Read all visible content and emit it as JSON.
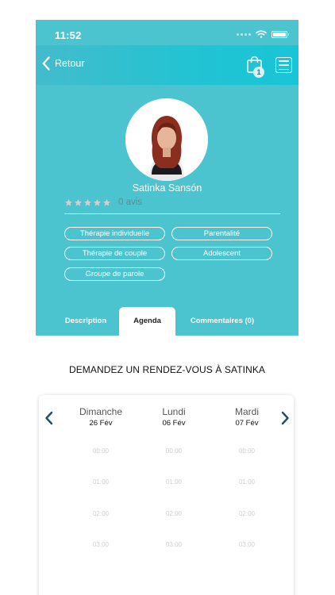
{
  "status": {
    "time": "11:52"
  },
  "nav": {
    "back_label": "Retour",
    "cart_count": "1"
  },
  "profile": {
    "name": "Satinka Sansón",
    "rating_stars": 5,
    "rating_value": 0,
    "reviews_label": "0 avis",
    "tags": [
      "Thérapie individuelle",
      "Parentalité",
      "Thérapie de couple",
      "Adolescent",
      "Groupe de parole"
    ]
  },
  "tabs": [
    {
      "label": "Description",
      "active": false
    },
    {
      "label": "Agenda",
      "active": true
    },
    {
      "label": "Commentaires (0)",
      "active": false
    }
  ],
  "agenda": {
    "title": "DEMANDEZ UN RENDEZ-VOUS À SATINKA",
    "days": [
      {
        "name": "Dimanche",
        "date": "26 Fév"
      },
      {
        "name": "Lundi",
        "date": "06 Fév"
      },
      {
        "name": "Mardi",
        "date": "07 Fév"
      }
    ],
    "slots": [
      "00:00",
      "01:00",
      "02:00",
      "03:00"
    ]
  },
  "colors": {
    "teal": "#4cc4d0",
    "nav_gradient_end": "#18c5d6",
    "star": "#c9d3d4",
    "slot_text": "#cfcfcf",
    "arrow": "#1e4e6e"
  }
}
